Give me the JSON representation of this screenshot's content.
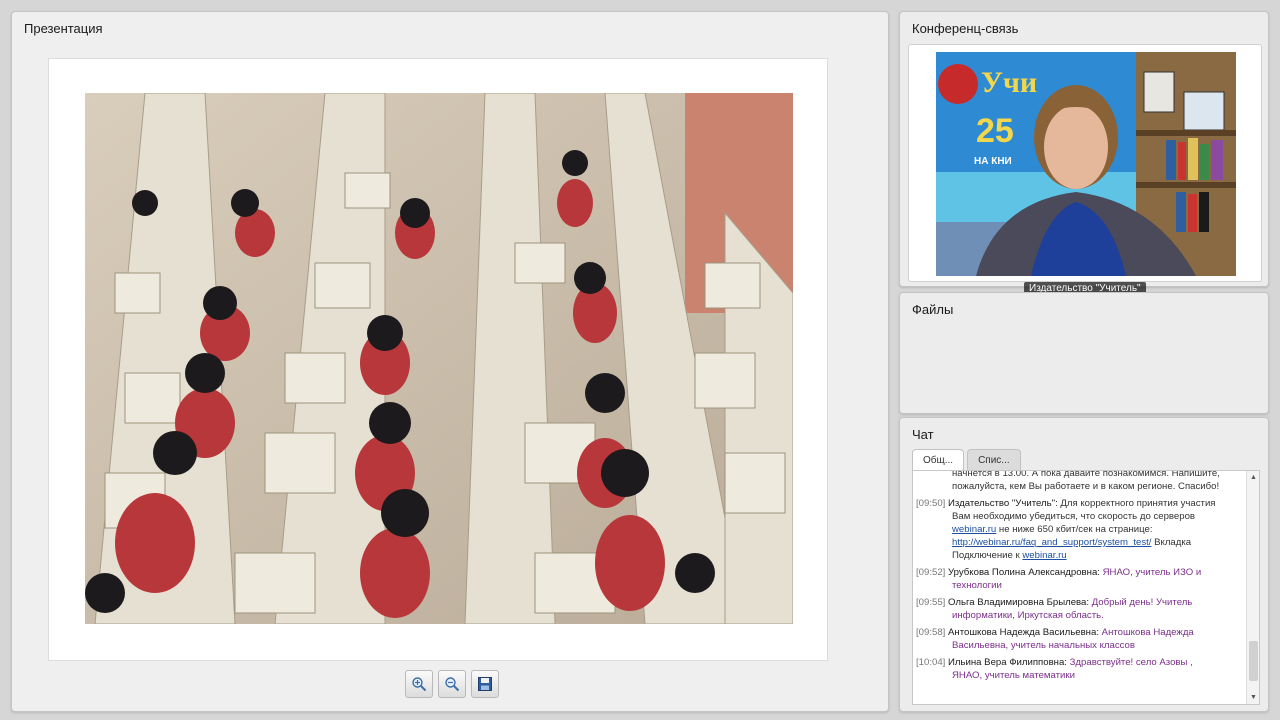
{
  "presentation": {
    "title": "Презентация"
  },
  "toolbar": {
    "zoom_in_icon": "zoom-in-icon",
    "zoom_out_icon": "zoom-out-icon",
    "save_icon": "save-icon"
  },
  "conference": {
    "title": "Конференц-связь",
    "video_caption": "Издательство \"Учитель\""
  },
  "files": {
    "title": "Файлы"
  },
  "chat": {
    "title": "Чат",
    "tabs": [
      {
        "label": "Общ..."
      },
      {
        "label": "Спис..."
      }
    ],
    "messages": [
      {
        "text_cont1": "начнется в 13.00. А пока давайте познакомимся. Напишите,",
        "text_cont2": "пожалуйста, кем Вы работаете и в каком регионе. Спасибо!"
      },
      {
        "time": "[09:50]",
        "author": "Издательство \"Учитель\":",
        "text": "Для корректного принятия участия",
        "cont1": "Вам необходимо убедиться, что скорость до серверов",
        "link1": "webinar.ru",
        "cont2": " не ниже 650 кбит/сек на странице:",
        "link2": "http://webinar.ru/faq_and_support/system_test/",
        "cont3": " Вкладка",
        "cont4": "Подключение к ",
        "link3": "webinar.ru"
      },
      {
        "time": "[09:52]",
        "author": "Урубкова Полина Александровна:",
        "text": "ЯНАО, учитель ИЗО и",
        "cont1": "технологии"
      },
      {
        "time": "[09:55]",
        "author": "Ольга Владимировна Брылева:",
        "text": "Добрый день! Учитель",
        "cont1": "информатики, Иркутская область."
      },
      {
        "time": "[09:58]",
        "author": "Антошкова Надежда Васильевна:",
        "text": "Антошкова Надежда",
        "cont1": "Васильевна, учитель начальных классов"
      },
      {
        "time": "[10:04]",
        "author": "Ильина Вера Филипповна:",
        "text": "Здравствуйте! село Азовы ,",
        "cont1": "ЯНАО, учитель математики"
      }
    ]
  },
  "colors": {
    "panel_bg": "#ececec",
    "chat_time": "#777777",
    "chat_purple": "#7a2f8a",
    "chat_link": "#1d4fa0"
  }
}
